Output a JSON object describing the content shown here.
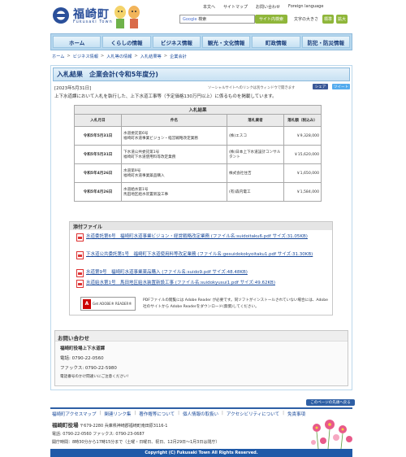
{
  "header": {
    "logo_text": "福崎町",
    "logo_sub": "Fukusaki Town",
    "links": [
      "本文へ",
      "サイトマップ",
      "お問い合わせ",
      "Foreign language"
    ],
    "search_label": "Google",
    "search_value": "検索",
    "search_button": "サイト内検索",
    "font_size_label": "文字の大きさ",
    "font_standard": "標準",
    "font_large": "拡大"
  },
  "nav": [
    "ホーム",
    "くらしの情報",
    "ビジネス情報",
    "観光・文化情報",
    "町政情報",
    "防犯・防災情報"
  ],
  "breadcrumb": [
    "ホーム",
    "ビジネス情報",
    "入札等の情報",
    "入札結果等",
    "企業会計"
  ],
  "main": {
    "title": "入札結果　企業会計(令和5年度分)",
    "date": "[2023年5月31日]",
    "social_note": "ソーシャルサイトへのリンクは別ウィンドウで開きます",
    "share_fb": "シェア",
    "share_tw": "ツイート",
    "intro": "上下水道課において入札を執行した、上下水道工事等（予定価格130万円以上）に係るものを掲載しています。",
    "table": {
      "caption": "入札結果",
      "headers": [
        "入札月日",
        "件名",
        "落札業者",
        "落札額（税込み）"
      ],
      "rows": [
        {
          "date": "令和5年5月31日",
          "name1": "水道委託第6号",
          "name2": "福崎町水道事業ビジョン・経営戦略改定業務",
          "vendor": "(株)エスコ",
          "price": "￥9,328,000"
        },
        {
          "date": "令和5年5月31日",
          "name1": "下水道公共委託第1号",
          "name2": "福崎町下水道使用料等改定業務",
          "vendor": "(株)日本上下水道設計コンサルタント",
          "price": "￥15,620,000"
        },
        {
          "date": "令和5年4月26日",
          "name1": "水道第9号",
          "name2": "福崎町水道事業薬品購入",
          "vendor": "株式会社住吉",
          "price": "￥1,650,000"
        },
        {
          "date": "令和5年4月26日",
          "name1": "水道給水第1号",
          "name2": "馬田地区給水装置新設工事",
          "vendor": "(有)森内電工",
          "price": "￥1,584,000"
        }
      ]
    },
    "attachments_title": "添付ファイル",
    "attachments": [
      "水道委託第6号　福崎町水道事業ビジョン・経営戦略改定業務 (ファイル名:suidoitaku6.pdf サイズ:31.05KB)",
      "下水道公共委託第1号　福崎町下水道使用料等改定業務 (ファイル名:gesuidokokyoitaku1.pdf サイズ:31.30KB)",
      "水道第9号　福崎町水道事業薬品購入 (ファイル名:suido9.pdf サイズ:48.48KB)",
      "水道給水第1号　馬田地区給水装置新設工事 (ファイル名:suidokyusui1.pdf サイズ:49.62KB)"
    ],
    "reader_badge": "Get ADOBE® READER®",
    "reader_text": "PDFファイルの閲覧には Adobe Reader が必要です。同ソフトがインストールされていない場合には、Adobe 社のサイトから Adobe Readerをダウンロード(無償)してください。"
  },
  "contact": {
    "title": "お問い合わせ",
    "dept": "福崎町役場上下水道課",
    "tel": "電話: 0790-22-0560",
    "fax": "ファックス: 0790-22-5980",
    "note": "電話番号のかけ間違いにご注意ください!"
  },
  "footer": {
    "page_top": "このページの先頭へ戻る",
    "links": [
      "福崎町アクセスマップ",
      "関連リンク集",
      "著作権等について",
      "個人情報の取扱い",
      "アクセシビリティについて",
      "免責事項"
    ],
    "office": "福崎町役場",
    "address": "〒679-2280 兵庫県神崎郡福崎町南田原3116-1",
    "phone": "電話: 0790-22-0560 ファックス: 0790-23-0687",
    "hours": "開庁時間：8時30分から17時15分まで（土曜・日曜日、祝日、12月29日～1月3日は閉庁）",
    "copyright": "Copyright (C) Fukusaki Town All Rights Reserved."
  }
}
